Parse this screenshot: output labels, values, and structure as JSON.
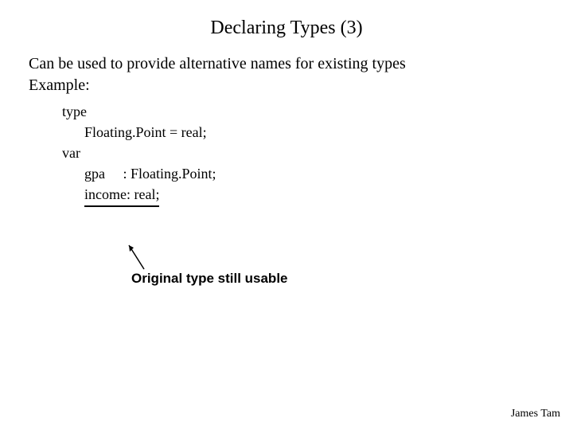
{
  "title": "Declaring Types (3)",
  "body": {
    "line1": "Can be used to provide alternative names for existing types",
    "line2": "Example:"
  },
  "code": {
    "l1": "type",
    "l2": "Floating.Point = real;",
    "l3": "var",
    "l4": "gpa  : Floating.Point;",
    "l5": "income: real;"
  },
  "annotation": "Original type still usable",
  "footer": "James Tam"
}
